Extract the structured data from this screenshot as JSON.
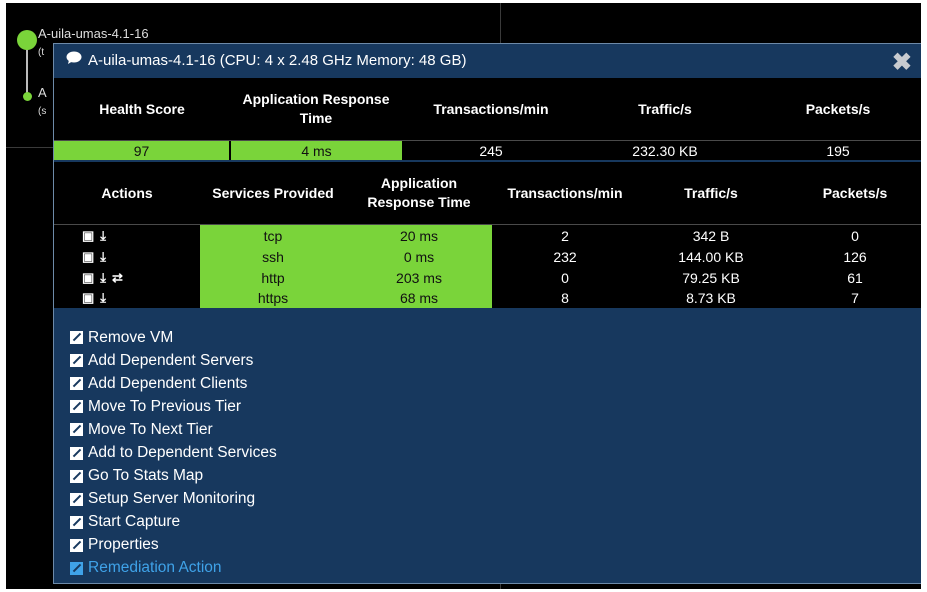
{
  "background": {
    "node1_label": "A-uila-umas-4.1-16",
    "node1_sub": "(t",
    "node2_label": "A",
    "node2_sub": "(s"
  },
  "popup": {
    "title": "A-uila-umas-4.1-16 (CPU: 4 x 2.48 GHz Memory: 48 GB)",
    "title_icon": "speech-bubble-icon",
    "close_icon": "close-x-icon",
    "close_glyph": "✖",
    "summary": {
      "headers": [
        "Health Score",
        "Application Response Time",
        "Transactions/min",
        "Traffic/s",
        "Packets/s"
      ],
      "values": [
        "97",
        "4 ms",
        "245",
        "232.30 KB",
        "195"
      ]
    },
    "services": {
      "headers": [
        "Actions",
        "Services Provided",
        "Application Response Time",
        "Transactions/min",
        "Traffic/s",
        "Packets/s"
      ],
      "rows": [
        {
          "actions": [
            "capture-icon",
            "download-icon"
          ],
          "service": "tcp",
          "response": "20 ms",
          "tpm": "2",
          "traffic": "342 B",
          "packets": "0"
        },
        {
          "actions": [
            "capture-icon",
            "download-icon"
          ],
          "service": "ssh",
          "response": "0 ms",
          "tpm": "232",
          "traffic": "144.00 KB",
          "packets": "126"
        },
        {
          "actions": [
            "capture-icon",
            "download-icon",
            "swap-arrows-icon"
          ],
          "service": "http",
          "response": "203 ms",
          "tpm": "0",
          "traffic": "79.25 KB",
          "packets": "61"
        },
        {
          "actions": [
            "capture-icon",
            "download-icon"
          ],
          "service": "https",
          "response": "68 ms",
          "tpm": "8",
          "traffic": "8.73 KB",
          "packets": "7"
        }
      ]
    },
    "menu": [
      "Remove VM",
      "Add Dependent Servers",
      "Add Dependent Clients",
      "Move To Previous Tier",
      "Move To Next Tier",
      "Add to Dependent Services",
      "Go To Stats Map",
      "Setup Server Monitoring",
      "Start Capture",
      "Properties",
      "Remediation Action"
    ],
    "colors": {
      "green": "#7ad43a",
      "panel": "#17385e",
      "link_blue": "#3fa2e8"
    }
  }
}
